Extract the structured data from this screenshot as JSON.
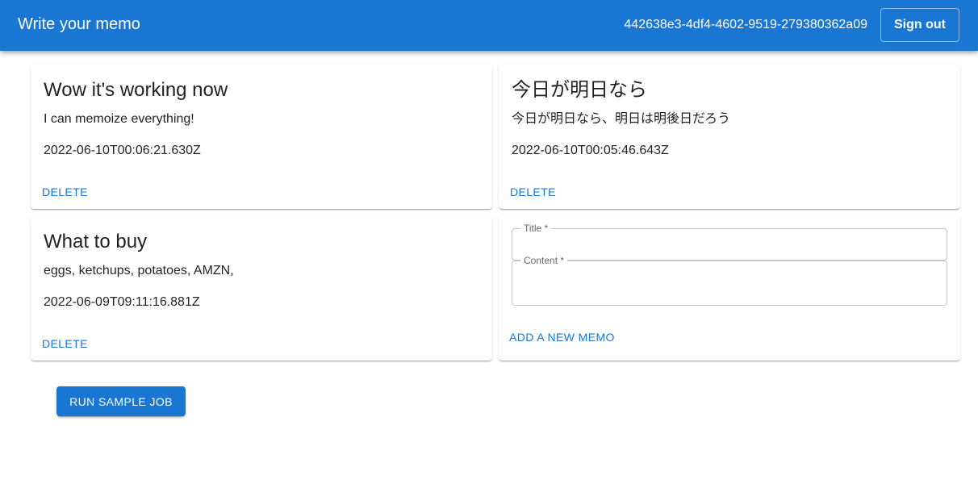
{
  "header": {
    "title": "Write your memo",
    "user_id": "442638e3-4df4-4602-9519-279380362a09",
    "signout_label": "Sign out"
  },
  "memos": [
    {
      "title": "Wow it's working now",
      "content": "I can memoize everything!",
      "date": "2022-06-10T00:06:21.630Z",
      "delete_label": "DELETE"
    },
    {
      "title": "今日が明日なら",
      "content": "今日が明日なら、明日は明後日だろう",
      "date": "2022-06-10T00:05:46.643Z",
      "delete_label": "DELETE"
    },
    {
      "title": "What to buy",
      "content": "eggs, ketchups, potatoes, AMZN,",
      "date": "2022-06-09T09:11:16.881Z",
      "delete_label": "DELETE"
    }
  ],
  "form": {
    "title_label": "Title *",
    "title_value": "",
    "content_label": "Content *",
    "content_value": "",
    "add_label": "ADD A NEW MEMO"
  },
  "run_job_label": "RUN SAMPLE JOB",
  "colors": {
    "primary": "#1976d2",
    "text": "#212121"
  }
}
